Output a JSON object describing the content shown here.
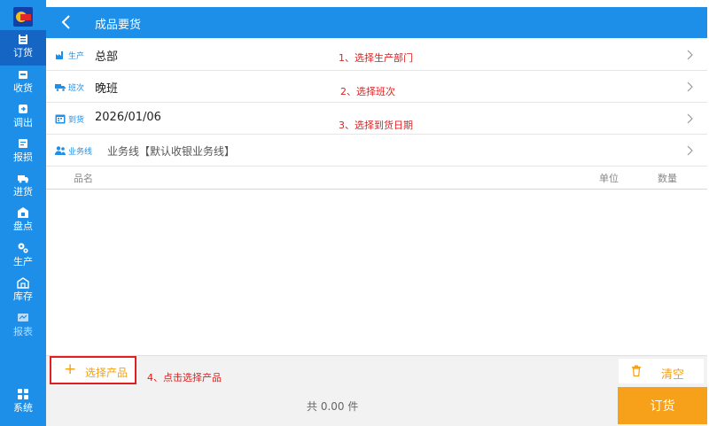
{
  "sidebar": {
    "items": [
      {
        "label": "订货",
        "icon": "clipboard-icon"
      },
      {
        "label": "收货",
        "icon": "receive-box-icon"
      },
      {
        "label": "调出",
        "icon": "transfer-out-icon"
      },
      {
        "label": "报损",
        "icon": "report-loss-icon"
      },
      {
        "label": "进货",
        "icon": "truck-icon"
      },
      {
        "label": "盘点",
        "icon": "inventory-check-icon"
      },
      {
        "label": "生产",
        "icon": "gear-icon"
      },
      {
        "label": "库存",
        "icon": "warehouse-icon"
      },
      {
        "label": "报表",
        "icon": "chart-icon"
      },
      {
        "label": "系统",
        "icon": "grid-icon"
      }
    ]
  },
  "header": {
    "title": "成品要货"
  },
  "form": {
    "production": {
      "tag": "生产",
      "value": "总部",
      "note": "1、选择生产部门"
    },
    "shift": {
      "tag": "班次",
      "value": "晚班",
      "note": "2、选择班次"
    },
    "arrival": {
      "tag": "到货",
      "value": "2026/01/06",
      "note": "3、选择到货日期"
    },
    "business": {
      "tag": "业务线",
      "value": "业务线【默认收银业务线】"
    }
  },
  "table": {
    "columns": {
      "name": "品名",
      "unit": "单位",
      "qty": "数量"
    }
  },
  "footer": {
    "select_label": "选择产品",
    "select_note": "4、点击选择产品",
    "clear_label": "清空",
    "total": "共 0.00 件",
    "order_label": "订货"
  },
  "colors": {
    "primary": "#1d8fe8",
    "accent": "#f7a11a",
    "annotation": "#e02020"
  }
}
